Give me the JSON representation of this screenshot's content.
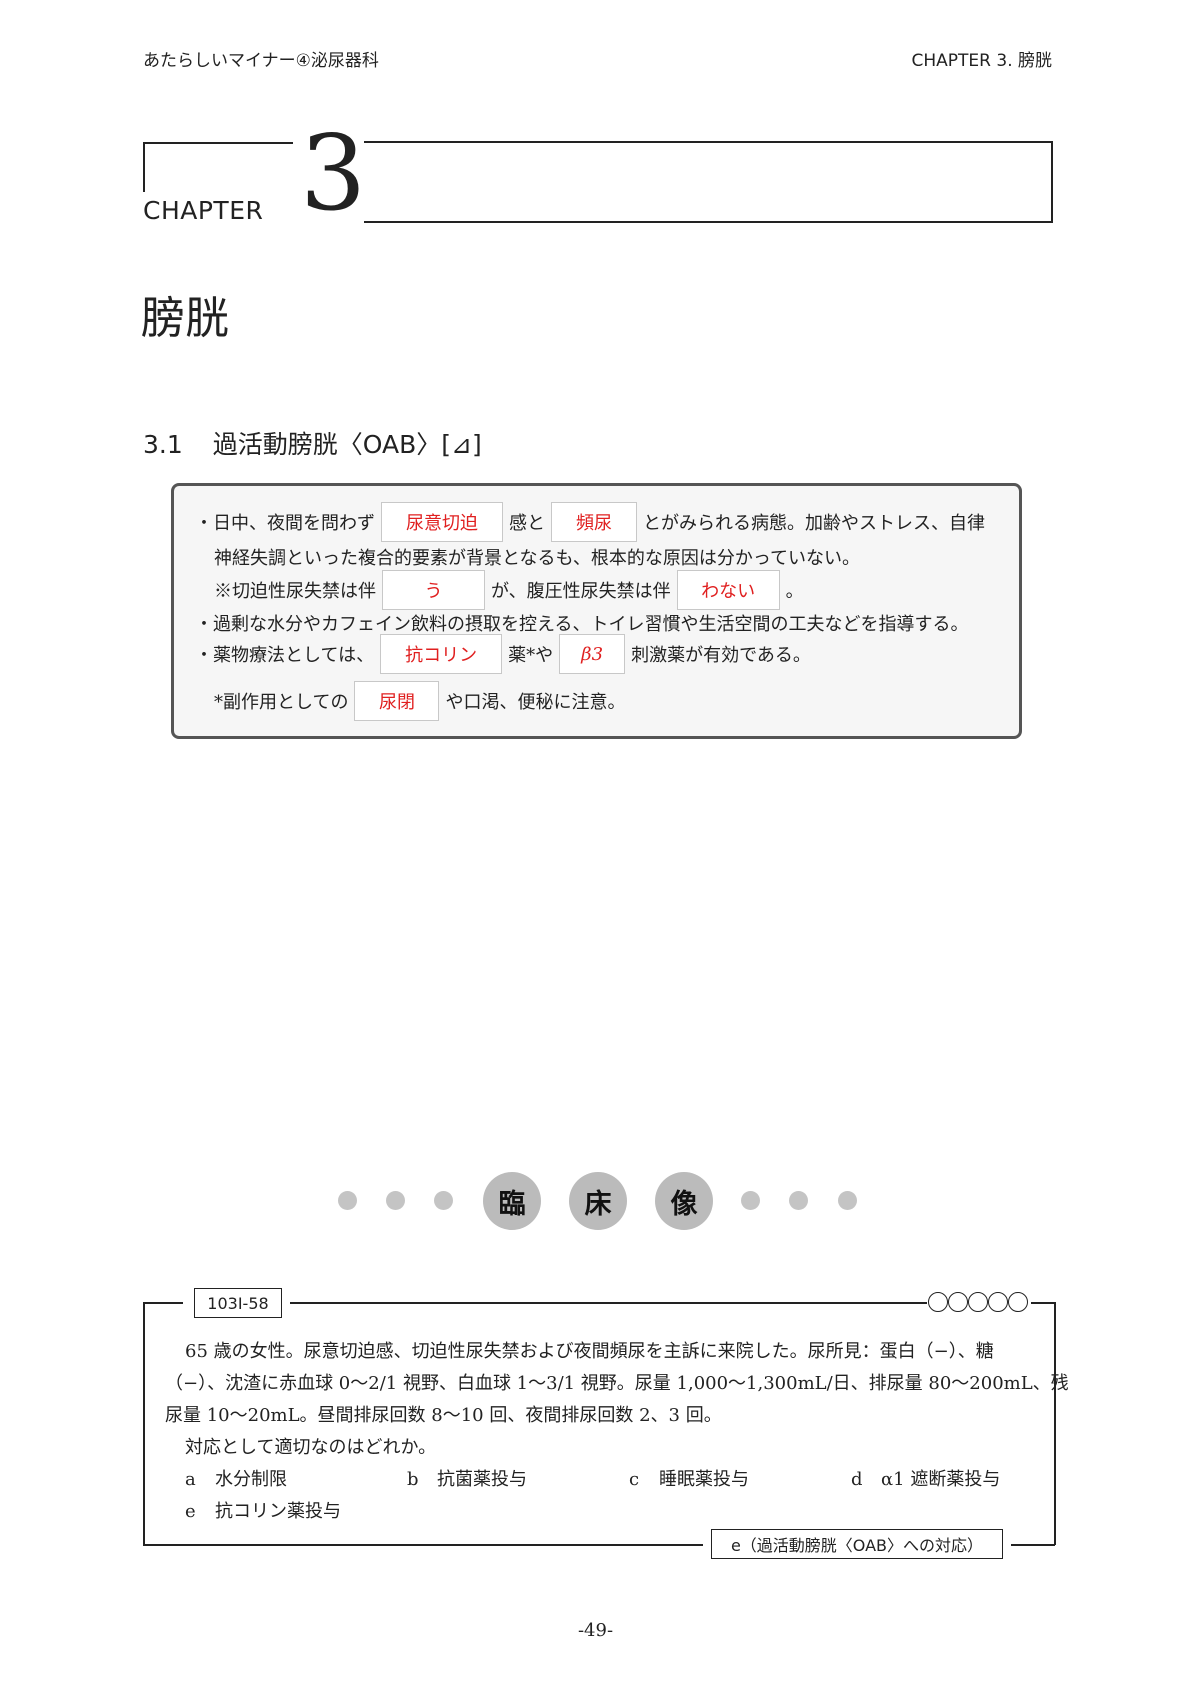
{
  "header": {
    "left": "あたらしいマイナー④泌尿器科",
    "right": "CHAPTER  3.  膀胱"
  },
  "chapter": {
    "word": "CHAPTER",
    "number": "3",
    "title": "膀胱"
  },
  "section": {
    "number": "3.1",
    "title": "過活動膀胱〈OAB〉[⊿]"
  },
  "summary": {
    "l1_a": "・日中、夜間を問わず",
    "l1_blank1": "尿意切迫",
    "l1_b": "感と",
    "l1_blank2": "頻尿",
    "l1_c": "とがみられる病態。加齢やストレス、自律",
    "l2": "神経失調といった複合的要素が背景となるも、根本的な原因は分かっていない。",
    "l3_a": "※切迫性尿失禁は伴",
    "l3_blank1": "う",
    "l3_b": "が、腹圧性尿失禁は伴",
    "l3_blank2": "わない",
    "l3_c": "。",
    "l4": "・過剰な水分やカフェイン飲料の摂取を控える、トイレ習慣や生活空間の工夫などを指導する。",
    "l5_a": "・薬物療法としては、",
    "l5_blank1": "抗コリン",
    "l5_b": "薬*や",
    "l5_blank2": "β3",
    "l5_c": "刺激薬が有効である。",
    "l6_a": "*副作用としての",
    "l6_blank1": "尿閉",
    "l6_b": "や口渇、便秘に注意。"
  },
  "clinical": {
    "c1": "臨",
    "c2": "床",
    "c3": "像"
  },
  "question": {
    "id": "103I-58",
    "line1": "65 歳の女性。尿意切迫感、切迫性尿失禁および夜間頻尿を主訴に来院した。尿所見：蛋白（−）、糖",
    "line2": "（−）、沈渣に赤血球 0〜2/1 視野、白血球 1〜3/1 視野。尿量 1,000〜1,300mL/日、排尿量 80〜200mL、残",
    "line3": "尿量 10〜20mL。昼間排尿回数 8〜10 回、夜間排尿回数 2、3 回。",
    "prompt": "対応として適切なのはどれか。",
    "choices": [
      {
        "letter": "a",
        "text": "水分制限"
      },
      {
        "letter": "b",
        "text": "抗菌薬投与"
      },
      {
        "letter": "c",
        "text": "睡眠薬投与"
      },
      {
        "letter": "d",
        "text": "α1 遮断薬投与"
      },
      {
        "letter": "e",
        "text": "抗コリン薬投与"
      }
    ],
    "answer": "e（過活動膀胱〈OAB〉への対応）"
  },
  "page_number": "-49-"
}
